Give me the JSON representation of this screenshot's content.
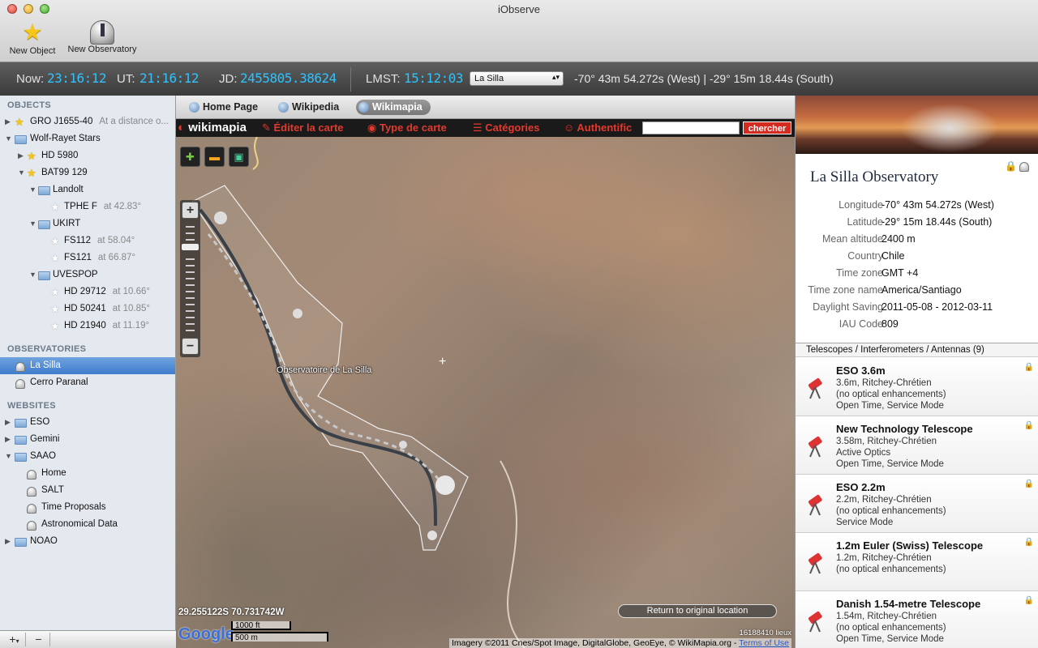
{
  "window": {
    "title": "iObserve"
  },
  "toolbar": {
    "new_object": "New Object",
    "new_observatory": "New Observatory"
  },
  "timebar": {
    "now_label": "Now:",
    "now_value": "23:16:12",
    "ut_label": "UT:",
    "ut_value": "21:16:12",
    "jd_label": "JD:",
    "jd_value": "2455805.38624",
    "lmst_label": "LMST:",
    "lmst_value": "15:12:03",
    "site_selected": "La Silla",
    "coords": "-70° 43m 54.272s (West) | -29° 15m 18.44s (South)"
  },
  "sidebar": {
    "objects_header": "OBJECTS",
    "objects": [
      {
        "label": "GRO J1655-40",
        "sub": "At a distance o..."
      },
      {
        "label": "Wolf-Rayet Stars",
        "sub": ""
      },
      {
        "label": "HD 5980",
        "sub": ""
      },
      {
        "label": "BAT99 129",
        "sub": ""
      },
      {
        "label": "Landolt",
        "sub": ""
      },
      {
        "label": "TPHE F",
        "sub": "at 42.83°"
      },
      {
        "label": "UKIRT",
        "sub": ""
      },
      {
        "label": "FS112",
        "sub": "at 58.04°"
      },
      {
        "label": "FS121",
        "sub": "at 66.87°"
      },
      {
        "label": "UVESPOP",
        "sub": ""
      },
      {
        "label": "HD 29712",
        "sub": "at 10.66°"
      },
      {
        "label": "HD 50241",
        "sub": "at 10.85°"
      },
      {
        "label": "HD 21940",
        "sub": "at 11.19°"
      }
    ],
    "observatories_header": "OBSERVATORIES",
    "observatories": [
      "La Silla",
      "Cerro Paranal"
    ],
    "websites_header": "WEBSITES",
    "websites": [
      "ESO",
      "Gemini",
      "SAAO",
      "Home",
      "SALT",
      "Time Proposals",
      "Astronomical Data",
      "NOAO"
    ],
    "add_button": "+",
    "remove_button": "−"
  },
  "tabs": {
    "home": "Home Page",
    "wikipedia": "Wikipedia",
    "wikimapia": "Wikimapia"
  },
  "wikimapia": {
    "logo_prefix": "wiki",
    "logo_suffix": "mapia",
    "edit": "Éditer la carte",
    "map_type": "Type de carte",
    "categories": "Catégories",
    "auth": "Authentific",
    "search_button": "chercher"
  },
  "map": {
    "place_label": "Observatoire de La Silla",
    "latlon": "29.255122S 70.731742W",
    "return_button": "Return to original location",
    "google": "Google",
    "scale_ft": "1000 ft",
    "scale_m": "500 m",
    "places_count": "16188410 lieux",
    "copyright": "Imagery ©2011 Cnes/Spot Image, DigitalGlobe, GeoEye, © WikiMapia.org -",
    "terms": "Terms of Use"
  },
  "observatory": {
    "name": "La Silla Observatory",
    "fields": [
      {
        "key": "Longitude",
        "value": "-70° 43m 54.272s (West)"
      },
      {
        "key": "Latitude",
        "value": "-29° 15m 18.44s (South)"
      },
      {
        "key": "Mean altitude",
        "value": "2400 m"
      },
      {
        "key": "Country",
        "value": "Chile"
      },
      {
        "key": "Time zone",
        "value": "GMT  +4"
      },
      {
        "key": "Time zone name",
        "value": "America/Santiago"
      },
      {
        "key": "Daylight Saving",
        "value": "2011-05-08 - 2012-03-11"
      },
      {
        "key": "IAU Code",
        "value": "809"
      }
    ]
  },
  "telescopes": {
    "header": "Telescopes / Interferometers / Antennas (9)",
    "items": [
      {
        "name": "ESO 3.6m",
        "l1": "3.6m, Ritchey-Chrétien",
        "l2": "(no optical enhancements)",
        "l3": "Open Time, Service Mode"
      },
      {
        "name": "New Technology Telescope",
        "l1": "3.58m, Ritchey-Chrétien",
        "l2": "Active Optics",
        "l3": "Open Time, Service Mode"
      },
      {
        "name": "ESO 2.2m",
        "l1": "2.2m, Ritchey-Chrétien",
        "l2": "(no optical enhancements)",
        "l3": "Service Mode"
      },
      {
        "name": "1.2m Euler (Swiss) Telescope",
        "l1": "1.2m, Ritchey-Chrétien",
        "l2": "(no optical enhancements)",
        "l3": ""
      },
      {
        "name": "Danish 1.54-metre Telescope",
        "l1": "1.54m, Ritchey-Chrétien",
        "l2": "(no optical enhancements)",
        "l3": "Open Time, Service Mode"
      }
    ]
  },
  "colors": {
    "accent_time": "#2ec3ff",
    "selection": "#3f7ccc",
    "wikimapia_red": "#e03a2f"
  }
}
